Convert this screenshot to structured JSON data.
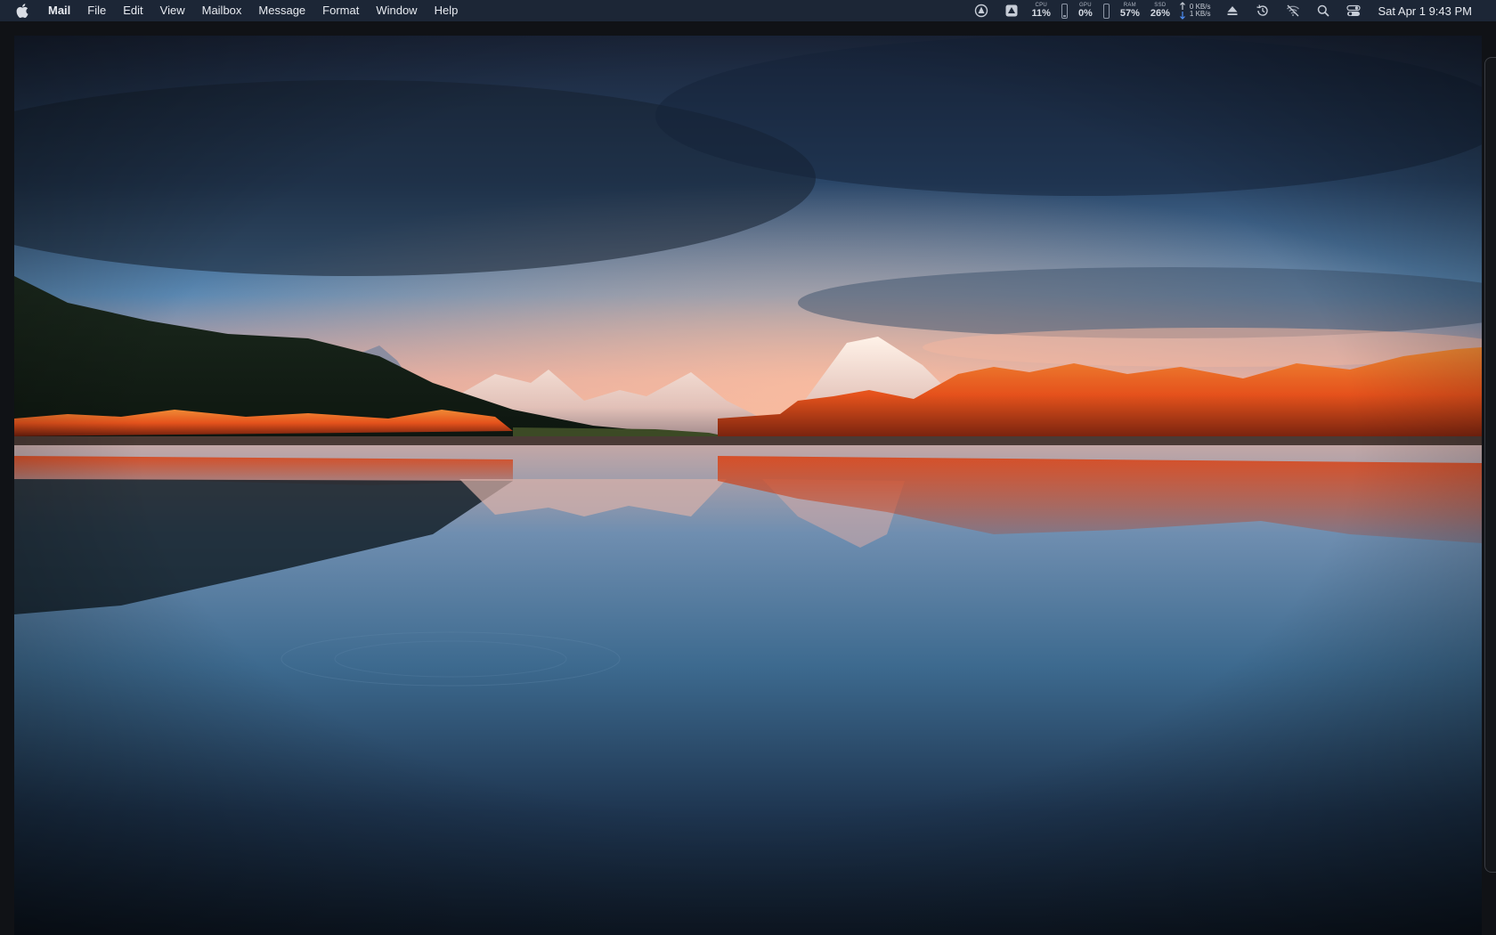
{
  "menubar": {
    "apple_icon": "apple-logo-icon",
    "app_name": "Mail",
    "items": [
      "File",
      "Edit",
      "View",
      "Mailbox",
      "Message",
      "Format",
      "Window",
      "Help"
    ]
  },
  "status": {
    "cpu": {
      "label": "CPU",
      "value": "11%"
    },
    "gpu": {
      "label": "GPU",
      "value": "0%"
    },
    "ram": {
      "label": "RAM",
      "value": "57%"
    },
    "ssd": {
      "label": "SSD",
      "value": "26%"
    },
    "network": {
      "up": "0 KB/s",
      "down": "1 KB/s"
    },
    "gauges": {
      "cpu_fill": 0.11,
      "gpu_fill": 0.0
    },
    "clock": "Sat Apr 1  9:43 PM",
    "icons": [
      "vpn-icon",
      "drive-icon",
      "eject-icon",
      "time-machine-icon",
      "wifi-off-icon",
      "search-icon",
      "control-center-icon"
    ]
  },
  "colors": {
    "menubar_bg": "#1c2636",
    "foliage": "#e5521c",
    "sky_glow": "#f1a98c",
    "water": "#3d6a8f"
  }
}
